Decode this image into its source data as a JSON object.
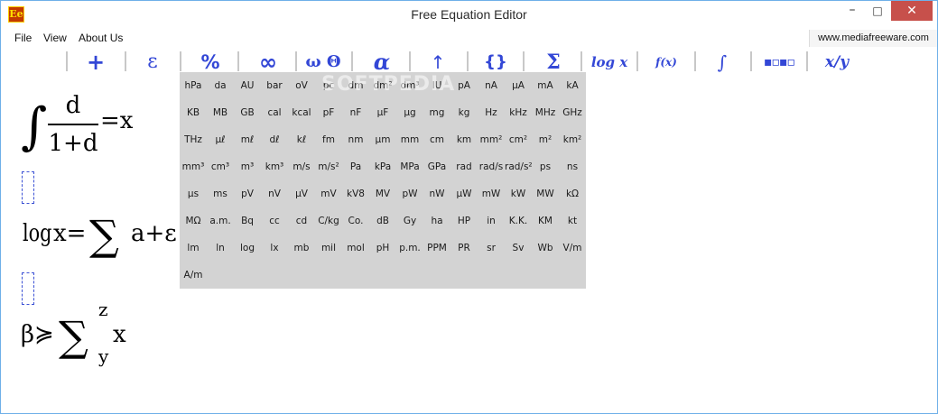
{
  "window": {
    "title": "Free Equation Editor",
    "icon_text": "Ee",
    "controls": {
      "minimize": "–",
      "maximize": "□",
      "close": "✕"
    }
  },
  "menu": {
    "file": "File",
    "view": "View",
    "about": "About Us",
    "site": "www.mediafreeware.com"
  },
  "toolbar": {
    "plus": "+",
    "epsilon": "ε",
    "percent": "%",
    "infinity": "∞",
    "omega_theta": "ω Θ",
    "alpha": "α",
    "arrow": "↑",
    "braces": "{}",
    "sigma": "Σ",
    "logx": "log x",
    "fx": "f(x)",
    "integral": "∫",
    "script": "▪▫▪▫",
    "fraction": "x/y"
  },
  "units": [
    "hPa",
    "da",
    "AU",
    "bar",
    "oV",
    "pc",
    "dm",
    "dm²",
    "dm³",
    "IU",
    "pA",
    "nA",
    "μA",
    "mA",
    "kA",
    "KB",
    "MB",
    "GB",
    "cal",
    "kcal",
    "pF",
    "nF",
    "μF",
    "μg",
    "mg",
    "kg",
    "Hz",
    "kHz",
    "MHz",
    "GHz",
    "THz",
    "μℓ",
    "mℓ",
    "dℓ",
    "kℓ",
    "fm",
    "nm",
    "μm",
    "mm",
    "cm",
    "km",
    "mm²",
    "cm²",
    "m²",
    "km²",
    "mm³",
    "cm³",
    "m³",
    "km³",
    "m/s",
    "m/s²",
    "Pa",
    "kPa",
    "MPa",
    "GPa",
    "rad",
    "rad/s",
    "rad/s²",
    "ps",
    "ns",
    "μs",
    "ms",
    "pV",
    "nV",
    "μV",
    "mV",
    "kV8",
    "MV",
    "pW",
    "nW",
    "μW",
    "mW",
    "kW",
    "MW",
    "kΩ",
    "MΩ",
    "a.m.",
    "Bq",
    "cc",
    "cd",
    "C/kg",
    "Co.",
    "dB",
    "Gy",
    "ha",
    "HP",
    "in",
    "K.K.",
    "KM",
    "kt",
    "lm",
    "ln",
    "log",
    "lx",
    "mb",
    "mil",
    "mol",
    "pH",
    "p.m.",
    "PPM",
    "PR",
    "sr",
    "Sv",
    "Wb",
    "V/m",
    "A/m"
  ],
  "watermark": "SOFTPEDIA",
  "equations": {
    "eq1": {
      "integral": "∫",
      "numerator": "d",
      "denominator": "1+d",
      "rhs": "=x"
    },
    "eq2": {
      "log": "log",
      "rest1": "x=",
      "sigma": "∑",
      "rest2": "a+ε"
    },
    "eq3": {
      "beta": "β≽",
      "sigma": "∑",
      "upper": "z",
      "lower": "y",
      "rest": "x"
    }
  }
}
